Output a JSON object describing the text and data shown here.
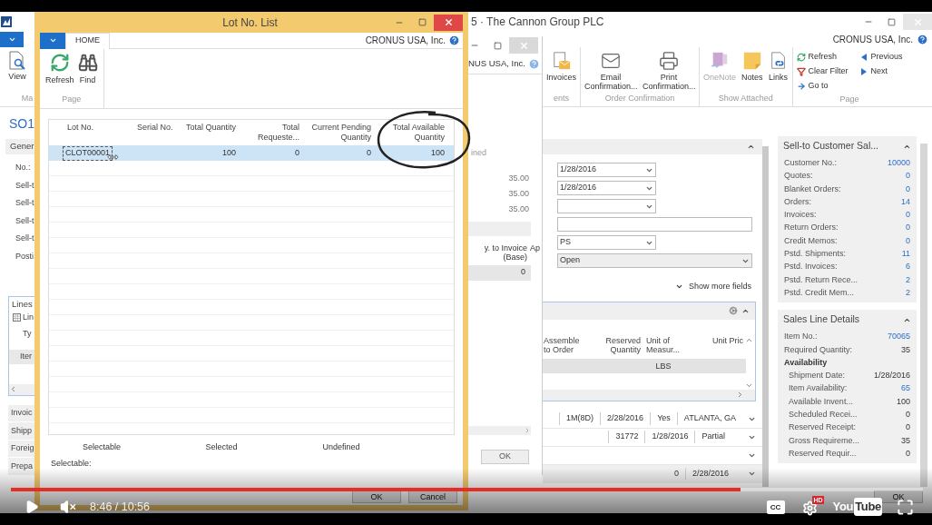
{
  "main_window": {
    "title": "5 · The Cannon Group PLC",
    "company": "CRONUS USA, Inc.",
    "ribbon_left": {
      "action": "View",
      "group": "Ma"
    },
    "ribbon_groups": [
      {
        "label": "ents",
        "actions": [
          {
            "label": "Invoices",
            "disabled": false
          }
        ]
      },
      {
        "label": "Order Confirmation",
        "actions": [
          {
            "label": "Email Confirmation...",
            "disabled": false
          },
          {
            "label": "Print Confirmation...",
            "disabled": false
          }
        ]
      },
      {
        "label": "Show Attached",
        "actions": [
          {
            "label": "OneNote",
            "disabled": true
          },
          {
            "label": "Notes",
            "disabled": false
          },
          {
            "label": "Links",
            "disabled": false
          }
        ]
      }
    ],
    "page_group": {
      "label": "Page",
      "actions": [
        {
          "label": "Refresh"
        },
        {
          "label": "Clear Filter"
        },
        {
          "label": "Go to"
        },
        {
          "label": "Previous"
        },
        {
          "label": "Next"
        }
      ]
    },
    "page_heading": "SO1",
    "left_column": {
      "general": "Gener",
      "fields": [
        "No.:",
        "Sell-t",
        "Sell-t",
        "Sell-t",
        "Sell-t",
        "Posti"
      ],
      "lines_title": "Lines",
      "lines_toolbar": "Lin",
      "lines_column": "Ty",
      "lines_row": "Iter",
      "collapsed_sections": [
        "Invoic",
        "Shipp",
        "Foreig",
        "Prepa"
      ]
    },
    "general_fields": [
      {
        "kind": "dropdown",
        "value": "1/28/2016"
      },
      {
        "kind": "dropdown",
        "value": "1/28/2016"
      },
      {
        "kind": "dropdown"
      },
      {
        "kind": "text"
      },
      {
        "kind": "dropdown",
        "value": "PS"
      },
      {
        "kind": "status",
        "value": "Open"
      }
    ],
    "show_more": "Show more fields",
    "lines": {
      "columns": [
        "Assemble to Order",
        "Reserved Quantity",
        "Unit of Measur...",
        "Unit Pric"
      ],
      "unit": "LBS"
    },
    "bottom_rows": [
      [
        "1M(8D)",
        "2/28/2016",
        "Yes",
        "ATLANTA, GA"
      ],
      [
        "31772",
        "1/28/2016",
        "Partial"
      ]
    ],
    "bottom_last_row": [
      "0",
      "2/28/2016"
    ],
    "factboxes": [
      {
        "title": "Sell-to Customer Sal...",
        "rows": [
          {
            "kind": "row",
            "label": "Customer No.:",
            "value": "10000",
            "link": true
          },
          {
            "kind": "row",
            "label": "Quotes:",
            "value": "0",
            "link": true
          },
          {
            "kind": "row",
            "label": "Blanket Orders:",
            "value": "0",
            "link": true
          },
          {
            "kind": "row",
            "label": "Orders:",
            "value": "14",
            "link": true
          },
          {
            "kind": "row",
            "label": "Invoices:",
            "value": "0",
            "link": true
          },
          {
            "kind": "row",
            "label": "Return Orders:",
            "value": "0",
            "link": true
          },
          {
            "kind": "row",
            "label": "Credit Memos:",
            "value": "0",
            "link": true
          },
          {
            "kind": "row",
            "label": "Pstd. Shipments:",
            "value": "11",
            "link": true
          },
          {
            "kind": "row",
            "label": "Pstd. Invoices:",
            "value": "6",
            "link": true
          },
          {
            "kind": "row",
            "label": "Pstd. Return Rece...",
            "value": "2",
            "link": true
          },
          {
            "kind": "row",
            "label": "Pstd. Credit Mem...",
            "value": "2",
            "link": true
          }
        ]
      },
      {
        "title": "Sales Line Details",
        "rows": [
          {
            "kind": "row",
            "label": "Item No.:",
            "value": "70065",
            "link": true
          },
          {
            "kind": "row",
            "label": "Required Quantity:",
            "value": "35",
            "link": false
          },
          {
            "kind": "heading",
            "label": "Availability"
          },
          {
            "kind": "subrow",
            "label": "Shipment Date:",
            "value": "1/28/2016",
            "link": false
          },
          {
            "kind": "subrow",
            "label": "Item Availability:",
            "value": "65",
            "link": true
          },
          {
            "kind": "subrow",
            "label": "Available Invent...",
            "value": "100",
            "link": false
          },
          {
            "kind": "subrow",
            "label": "Scheduled Recei...",
            "value": "0",
            "link": false
          },
          {
            "kind": "subrow",
            "label": "Reserved Receipt:",
            "value": "0",
            "link": false
          },
          {
            "kind": "subrow",
            "label": "Gross Requireme...",
            "value": "35",
            "link": false
          },
          {
            "kind": "subrow",
            "label": "Reserved Requir...",
            "value": "0",
            "link": false
          }
        ]
      }
    ],
    "ok_button": "OK"
  },
  "middle_window": {
    "company": "NUS USA, Inc.",
    "status": "ined",
    "amounts": [
      "35.00",
      "35.00",
      "35.00"
    ],
    "columns": [
      "y. to Invoice (Base)",
      "Ap"
    ],
    "row_value": "0",
    "ok_button": "OK"
  },
  "lot_window": {
    "title": "Lot No. List",
    "tab": "HOME",
    "company": "CRONUS USA, Inc.",
    "actions": [
      {
        "label": "Refresh"
      },
      {
        "label": "Find"
      }
    ],
    "group": "Page",
    "columns": [
      "Lot No.",
      "Serial No.",
      "Total Quantity",
      "Total Requeste...",
      "Current Pending Quantity",
      "Total Available Quantity"
    ],
    "rows": [
      {
        "selected": true,
        "cells": [
          "CLOT00001",
          "",
          "100",
          "0",
          "0",
          "100"
        ]
      }
    ],
    "legend": [
      "Selectable",
      "Selected",
      "Undefined"
    ],
    "footer_label": "Selectable:",
    "buttons": [
      "OK",
      "Cancel"
    ]
  },
  "player": {
    "time": "8:46 / 10:56",
    "progress": {
      "level": 0.8
    },
    "muted": true,
    "captions": "CC",
    "hd_badge": "HD",
    "logo": {
      "you": "You",
      "tube": "Tube"
    }
  }
}
